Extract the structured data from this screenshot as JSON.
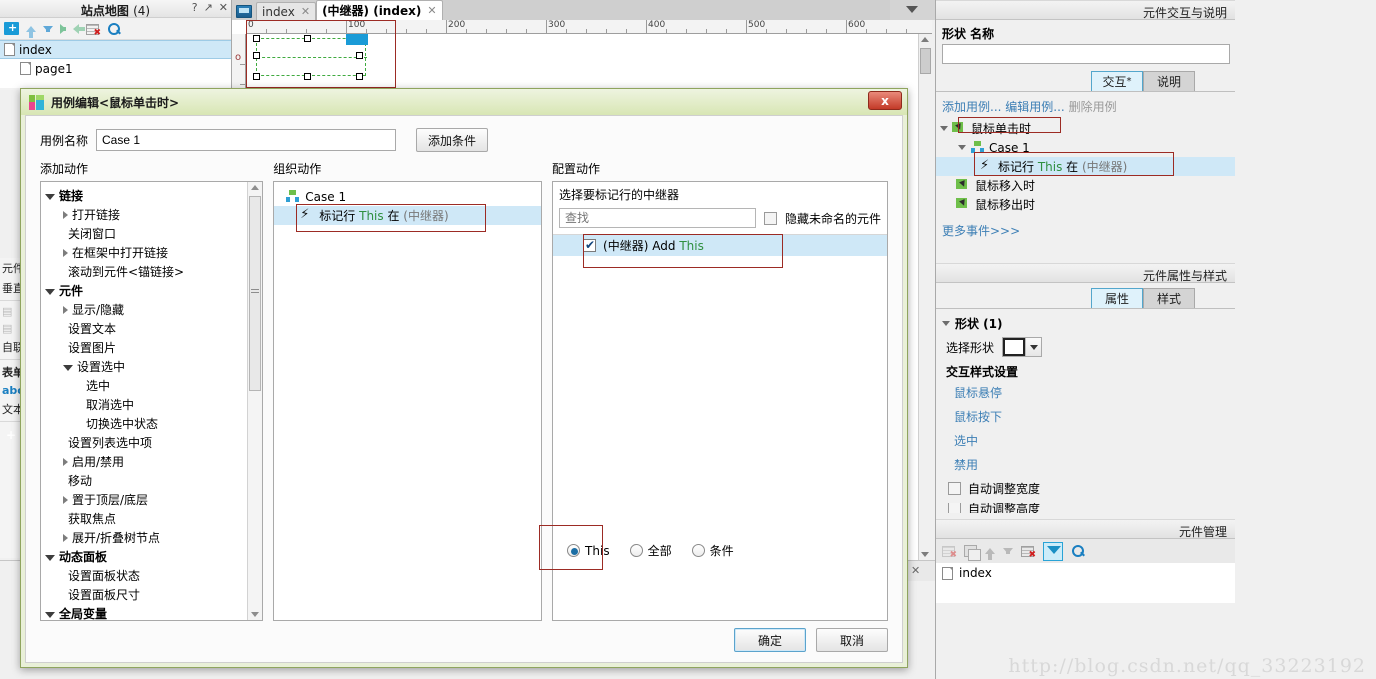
{
  "sitemap": {
    "title": "站点地图",
    "count": "(4)",
    "buttons": [
      "?",
      "↗",
      "✕"
    ],
    "toolbar_icons": [
      "add-folder-icon",
      "move-up-icon",
      "move-down-icon",
      "move-right-icon",
      "move-left-icon",
      "delete-icon",
      "search-icon"
    ],
    "items": [
      {
        "label": "index",
        "selected": true,
        "indent": 0
      },
      {
        "label": "page1",
        "selected": false,
        "indent": 1
      }
    ]
  },
  "left_widgets": {
    "rows": [
      "元件",
      "垂直",
      "",
      "",
      "",
      "自联排",
      "",
      "表单",
      "abc",
      "文本"
    ]
  },
  "tabs": {
    "items": [
      {
        "label": "index",
        "active": false,
        "close": "✕"
      },
      {
        "label": "(中继器) (index)",
        "active": true,
        "close": "✕"
      }
    ]
  },
  "canvas": {
    "ruler_labels": [
      "0",
      "100",
      "200",
      "300",
      "400",
      "500",
      "600"
    ]
  },
  "interactions_panel": {
    "header": "元件交互与说明",
    "name_label": "形状 名称",
    "name_value": "",
    "tabs": [
      {
        "label": "交互",
        "star": "*",
        "active": true
      },
      {
        "label": "说明",
        "star": "",
        "active": false
      }
    ],
    "links": [
      {
        "label": "添加用例...",
        "dim": false
      },
      {
        "label": "编辑用例...",
        "dim": false
      },
      {
        "label": "删除用例",
        "dim": true
      }
    ],
    "tree": [
      {
        "label": "鼠标单击时",
        "icon": "mouse-event-icon",
        "indent": 0,
        "expander": "open",
        "highlight": true
      },
      {
        "label": "Case 1",
        "icon": "case-icon",
        "indent": 1,
        "expander": "open",
        "highlight": false
      },
      {
        "label_parts": [
          "标记行 ",
          "This",
          " 在 ",
          "(中继器)"
        ],
        "icon": "bolt-icon",
        "indent": 2,
        "selected": true,
        "highlight": true
      },
      {
        "label": "鼠标移入时",
        "icon": "mouse-event-icon",
        "indent": 0
      },
      {
        "label": "鼠标移出时",
        "icon": "mouse-event-icon",
        "indent": 0
      }
    ],
    "more_events": "更多事件>>>"
  },
  "properties_panel": {
    "header": "元件属性与样式",
    "tabs": [
      {
        "label": "属性",
        "active": true
      },
      {
        "label": "样式",
        "active": false
      }
    ],
    "group_title": "形状 (1)",
    "shape_label": "选择形状",
    "style_section": "交互样式设置",
    "style_links": [
      "鼠标悬停",
      "鼠标按下",
      "选中",
      "禁用"
    ],
    "checkboxes": [
      {
        "label": "自动调整宽度",
        "checked": false
      },
      {
        "label": "自动调整高度",
        "checked": false
      }
    ]
  },
  "widget_manager": {
    "header": "元件管理",
    "toolbar_icons": [
      "new-widget-icon",
      "duplicate-icon",
      "move-up-icon",
      "move-down-icon",
      "delete-icon",
      "filter-icon",
      "search-icon"
    ],
    "items": [
      {
        "label": "index"
      }
    ]
  },
  "dialog": {
    "title": "用例编辑<鼠标单击时>",
    "close_label": "x",
    "case_name_label": "用例名称",
    "case_name_value": "Case 1",
    "add_condition_button": "添加条件",
    "add_action_label": "添加动作",
    "organize_action_label": "组织动作",
    "configure_action_label": "配置动作",
    "action_tree": [
      {
        "label": "链接",
        "level": 0,
        "expander": "open",
        "bold": true
      },
      {
        "label": "打开链接",
        "level": 1,
        "expander": "closed"
      },
      {
        "label": "关闭窗口",
        "level": 1,
        "expander": "none"
      },
      {
        "label": "在框架中打开链接",
        "level": 1,
        "expander": "closed"
      },
      {
        "label": "滚动到元件<锚链接>",
        "level": 1,
        "expander": "none"
      },
      {
        "label": "元件",
        "level": 0,
        "expander": "open",
        "bold": true
      },
      {
        "label": "显示/隐藏",
        "level": 1,
        "expander": "closed"
      },
      {
        "label": "设置文本",
        "level": 1,
        "expander": "none"
      },
      {
        "label": "设置图片",
        "level": 1,
        "expander": "none"
      },
      {
        "label": "设置选中",
        "level": 1,
        "expander": "open"
      },
      {
        "label": "选中",
        "level": 2,
        "expander": "none"
      },
      {
        "label": "取消选中",
        "level": 2,
        "expander": "none"
      },
      {
        "label": "切换选中状态",
        "level": 2,
        "expander": "none"
      },
      {
        "label": "设置列表选中项",
        "level": 1,
        "expander": "none"
      },
      {
        "label": "启用/禁用",
        "level": 1,
        "expander": "closed"
      },
      {
        "label": "移动",
        "level": 1,
        "expander": "none"
      },
      {
        "label": "置于顶层/底层",
        "level": 1,
        "expander": "closed"
      },
      {
        "label": "获取焦点",
        "level": 1,
        "expander": "none"
      },
      {
        "label": "展开/折叠树节点",
        "level": 1,
        "expander": "closed"
      },
      {
        "label": "动态面板",
        "level": 0,
        "expander": "open",
        "bold": true
      },
      {
        "label": "设置面板状态",
        "level": 1,
        "expander": "none"
      },
      {
        "label": "设置面板尺寸",
        "level": 1,
        "expander": "none"
      },
      {
        "label": "全局变量",
        "level": 0,
        "expander": "open",
        "bold": true
      }
    ],
    "organize_tree": [
      {
        "label": "Case 1",
        "icon": "case-icon",
        "level": 0,
        "expander": "open",
        "selected": false
      },
      {
        "label_parts": [
          "标记行 ",
          "This",
          " 在 ",
          "(中继器)"
        ],
        "icon": "bolt-icon",
        "level": 1,
        "selected": true,
        "highlight": true
      }
    ],
    "configure": {
      "select_label": "选择要标记行的中继器",
      "search_placeholder": "查找",
      "hide_unnamed_label": "隐藏未命名的元件",
      "hide_unnamed_checked": false,
      "items": [
        {
          "prefix": "(中继器)",
          "name": "Add",
          "suffix": "This",
          "checked": true,
          "selected": true
        }
      ],
      "radios": [
        {
          "label": "This",
          "selected": true,
          "highlight": true
        },
        {
          "label": "全部",
          "selected": false
        },
        {
          "label": "条件",
          "selected": false
        }
      ]
    },
    "ok_button": "确定",
    "cancel_button": "取消"
  },
  "watermark": "http://blog.csdn.net/qq_33223192"
}
